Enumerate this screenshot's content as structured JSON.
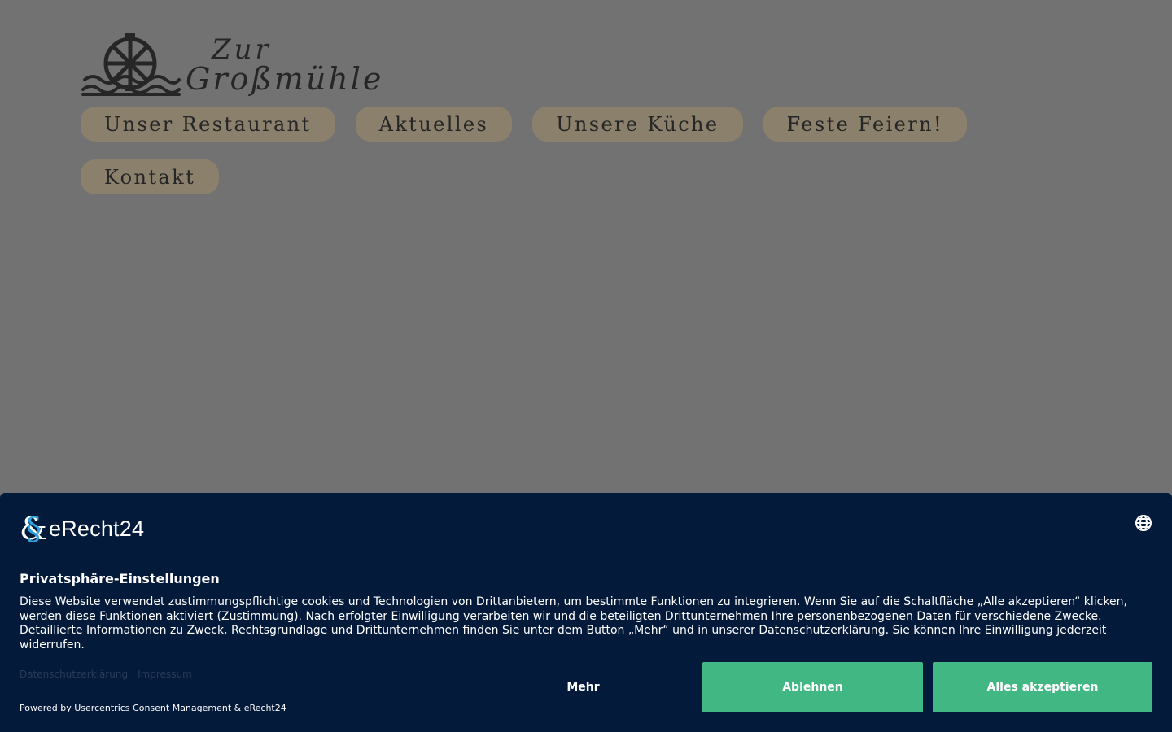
{
  "header": {
    "logo_line1": "Zur",
    "logo_line2": "Großmühle"
  },
  "nav": {
    "items": [
      {
        "label": "Unser Restaurant"
      },
      {
        "label": "Aktuelles"
      },
      {
        "label": "Unsere Küche"
      },
      {
        "label": "Feste Feiern!"
      },
      {
        "label": "Kontakt"
      }
    ]
  },
  "consent": {
    "brand": "eRecht24",
    "title": "Privatsphäre-Einstellungen",
    "text": "Diese Website verwendet zustimmungspflichtige cookies und Technologien von Drittanbietern, um bestimmte Funktionen zu integrieren. Wenn Sie auf die Schaltfläche „Alle akzeptieren“ klicken, werden diese Funktionen aktiviert (Zustimmung). Nach erfolgter Einwilligung verarbeiten wir und die beteiligten Drittunternehmen Ihre personenbezogenen Daten für verschiedene Zwecke. Detaillierte Informationen zu Zweck, Rechtsgrundlage und Drittunternehmen finden Sie unter dem Button „Mehr“ und in unserer Datenschutzerklärung. Sie können Ihre Einwilligung jederzeit widerrufen.",
    "links": {
      "privacy": "Datenschutzerklärung",
      "imprint": "Impressum"
    },
    "powered_by": "Powered by Usercentrics Consent Management & eRecht24",
    "buttons": {
      "more": "Mehr",
      "deny": "Ablehnen",
      "accept": "Alles akzeptieren"
    },
    "colors": {
      "background": "#031a3a",
      "button": "#41b883",
      "brand_accent": "#2fa3e0"
    },
    "icons": {
      "language": "globe-icon"
    }
  },
  "colors": {
    "page_overlay": "#727272",
    "nav_pill": "#8a806b"
  }
}
